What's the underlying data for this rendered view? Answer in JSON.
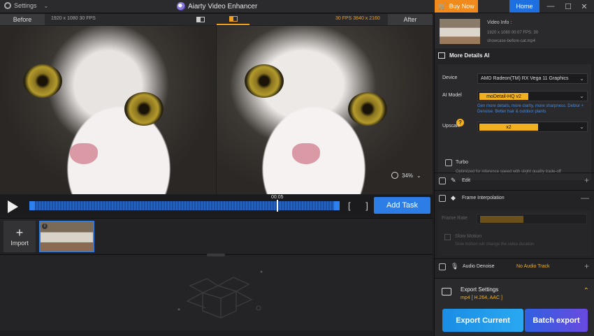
{
  "titlebar": {
    "settings_label": "Settings",
    "app_title": "Aiarty Video Enhancer",
    "buy_label": "Buy Now",
    "home_label": "Home",
    "minimize": "—",
    "maximize": "☐",
    "close": "✕"
  },
  "preview": {
    "before_label": "Before",
    "after_label": "After",
    "before_res": "1920 x 1080  30 FPS",
    "after_res": "30 FPS  3840 x 2160",
    "zoom": "34%"
  },
  "transport": {
    "time": "00:05",
    "brackets": "[ ]",
    "add_task_label": "Add Task"
  },
  "media": {
    "import_label": "Import"
  },
  "panel": {
    "video_info_title": "Video Info :",
    "video_info_line": "1920 x 1080  00:07  FPS: 30",
    "video_file": "showcase-before-cat.mp4",
    "section_title": "More Details AI",
    "device_label": "Device",
    "device_value": "AMD Radeon(TM) RX Vega 11 Graphics",
    "ai_model_label": "AI Model",
    "ai_model_value": "moDetail-HQ  v2",
    "ai_model_desc": "Gen more details, more clarity, more sharpness. Deblur + Denoise. Better hair & outdoor plants",
    "upscale_label": "Upscale",
    "upscale_value": "x2",
    "turbo_label": "Turbo",
    "turbo_desc": "Optimized for inference speed with slight quality trade-off",
    "edit_label": "Edit",
    "frame_interp_label": "Frame Interpolation",
    "frame_rate_label": "Frame Rate",
    "slow_motion_label": "Slow Motion",
    "slow_motion_desc": "Slow motion will change the video duration",
    "audio_label": "Audio Denoise",
    "no_audio": "No Audio Track",
    "export_title": "Export Settings",
    "export_format": "mp4 [ H.264, AAC ]",
    "export_current": "Export Current",
    "batch_export": "Batch export"
  }
}
